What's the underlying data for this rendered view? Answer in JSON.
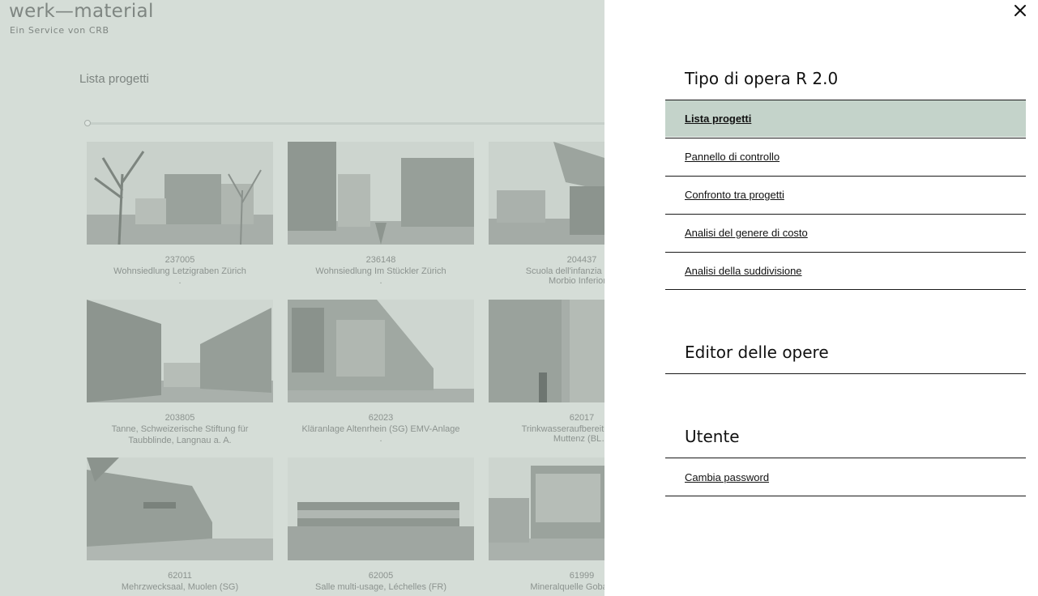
{
  "header": {
    "logo_title": "werk—material",
    "logo_subtitle": "Ein Service von CRB"
  },
  "main": {
    "title": "Lista progetti",
    "projects": [
      {
        "number": "237005",
        "name": "Wohnsiedlung Letzigraben Zürich",
        "extra": "."
      },
      {
        "number": "236148",
        "name": "Wohnsiedlung Im Stückler Zürich",
        "extra": "."
      },
      {
        "number": "204437",
        "name": "Scuola dell'infanzia e Piaz…",
        "extra": "Morbio Inferior…"
      },
      {
        "number": "203805",
        "name": "Tanne, Schweizerische Stiftung für Taubblinde, Langnau a. A.",
        "extra": ""
      },
      {
        "number": "62023",
        "name": "Kläranlage Altenrhein (SG) EMV-Anlage",
        "extra": "."
      },
      {
        "number": "62017",
        "name": "Trinkwasseraufbereitungsan…",
        "extra": "Muttenz (BL…"
      },
      {
        "number": "62011",
        "name": "Mehrzwecksaal, Muolen (SG)",
        "extra": ""
      },
      {
        "number": "62005",
        "name": "Salle multi-usage, Léchelles (FR)",
        "extra": ""
      },
      {
        "number": "61999",
        "name": "Mineralquelle Goba, Go…",
        "extra": ""
      }
    ]
  },
  "menu": {
    "section1": {
      "title": "Tipo di opera R 2.0",
      "items": [
        {
          "label": "Lista progetti"
        },
        {
          "label": "Pannello di controllo"
        },
        {
          "label": "Confronto tra progetti"
        },
        {
          "label": "Analisi del genere di costo"
        },
        {
          "label": "Analisi della suddivisione"
        }
      ]
    },
    "section2": {
      "title": "Editor delle opere"
    },
    "section3": {
      "title": "Utente",
      "items": [
        {
          "label": "Cambia password"
        }
      ]
    }
  },
  "icons": {
    "close": "close-icon"
  },
  "colors": {
    "overlay_bg": "#d5ddd7",
    "active_item": "#c4d3ca",
    "menu_bg": "#ffffff",
    "text": "#111111"
  }
}
